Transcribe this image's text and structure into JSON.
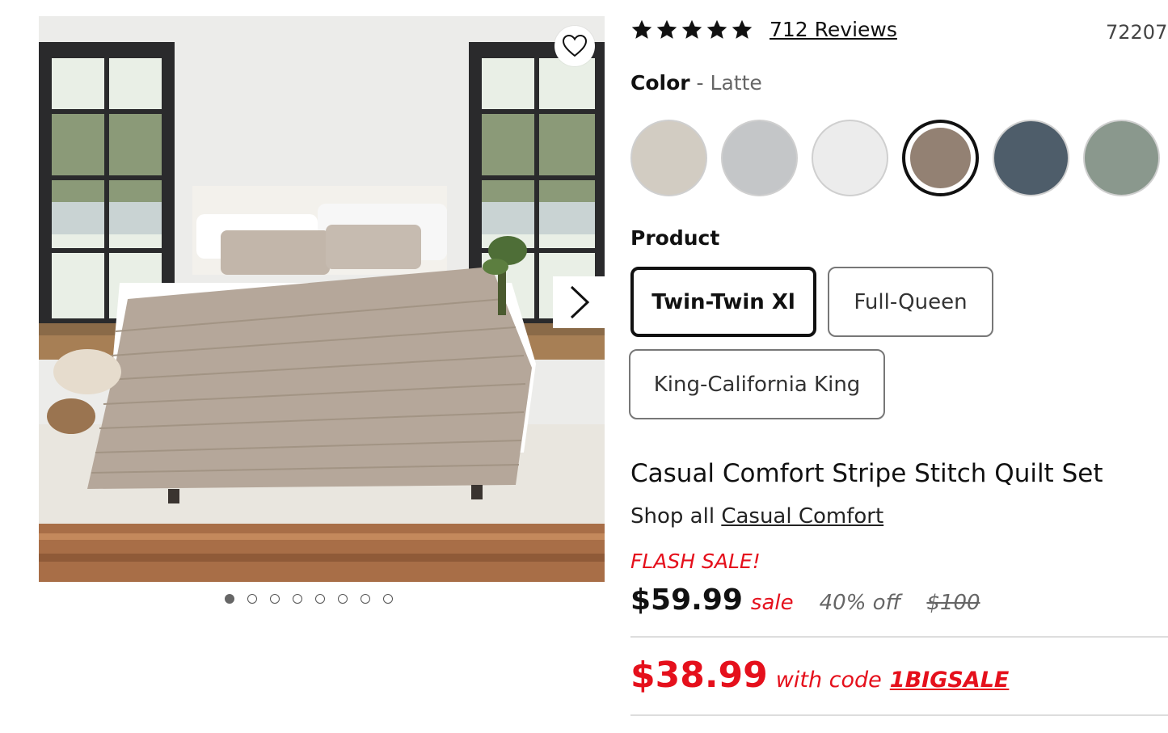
{
  "gallery": {
    "slide_count": 8,
    "active_slide": 1
  },
  "rating": {
    "stars": 5,
    "reviews_label": "712 Reviews"
  },
  "sku": "72207",
  "color": {
    "label": "Color",
    "separator": " - ",
    "selected": "Latte",
    "swatches": [
      {
        "name": "swatch-1",
        "hex": "#d2ccc2"
      },
      {
        "name": "swatch-2",
        "hex": "#c4c6c8"
      },
      {
        "name": "swatch-3",
        "hex": "#ececec"
      },
      {
        "name": "swatch-latte",
        "hex": "#938173",
        "selected": true
      },
      {
        "name": "swatch-5",
        "hex": "#4e5d6a"
      },
      {
        "name": "swatch-6",
        "hex": "#8a988d"
      }
    ]
  },
  "product": {
    "label": "Product",
    "sizes": [
      "Twin-Twin Xl",
      "Full-Queen",
      "King-California King"
    ],
    "selected": "Twin-Twin Xl"
  },
  "title": "Casual Comfort Stripe Stitch Quilt Set",
  "shop_all": {
    "prefix": "Shop all",
    "brand": "Casual Comfort"
  },
  "pricing": {
    "flash_label": "FLASH SALE!",
    "price": "$59.99",
    "sale_label": "sale",
    "discount": "40% off",
    "original": "$100",
    "code_price": "$38.99",
    "with_code_label": "with code",
    "code": "1BIGSALE"
  },
  "colors": {
    "accent_red": "#e5101c",
    "text": "#111111"
  }
}
